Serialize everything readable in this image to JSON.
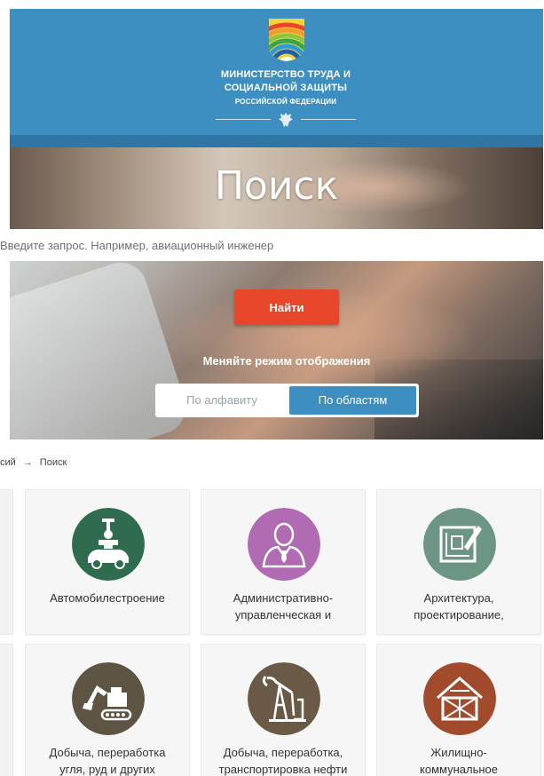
{
  "header": {
    "ministry_line1": "МИНИСТЕРСТВО ТРУДА И",
    "ministry_line2": "СОЦИАЛЬНОЙ ЗАЩИТЫ",
    "ministry_line3": "РОССИЙСКОЙ ФЕДЕРАЦИИ",
    "logo_icon": "ministry-rainbow-logo",
    "emblem_icon": "double-headed-eagle-emblem",
    "bg_color": "#3d8fc2"
  },
  "hero": {
    "title": "Поиск",
    "search_placeholder": "Введите запрос. Например, авиационный инженер",
    "find_button": "Найти",
    "mode_label": "Меняйте режим отображения",
    "mode_options": {
      "alphabet": "По алфавиту",
      "regions": "По областям"
    },
    "selected_mode": "regions",
    "accent_color": "#e8462b"
  },
  "breadcrumb": {
    "prev": "сий",
    "separator": "→",
    "current": "Поиск"
  },
  "categories": [
    {
      "label_line1": "Автомобилестроение",
      "label_line2": "",
      "icon": "car-assembly-icon",
      "color": "#2e6b4f"
    },
    {
      "label_line1": "Административно-",
      "label_line2": "управленческая и",
      "icon": "manager-person-icon",
      "color": "#b06bb3"
    },
    {
      "label_line1": "Архитектура,",
      "label_line2": "проектирование,",
      "icon": "blueprint-drawing-icon",
      "color": "#6c9583"
    },
    {
      "label_line1": "Добыча, переработка",
      "label_line2": "угля, руд и других",
      "icon": "excavator-icon",
      "color": "#5e5444"
    },
    {
      "label_line1": "Добыча, переработка,",
      "label_line2": "транспортировка нефти",
      "icon": "oil-pump-icon",
      "color": "#6a5a45"
    },
    {
      "label_line1": "Жилищно-",
      "label_line2": "коммунальное",
      "icon": "house-frame-icon",
      "color": "#a14a2c"
    }
  ]
}
